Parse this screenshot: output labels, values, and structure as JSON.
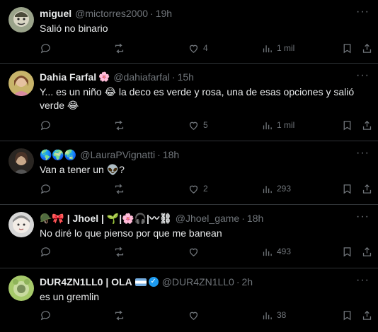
{
  "posts": [
    {
      "name": "miguel",
      "name_deco": "",
      "handle": "@mictorres2000",
      "time": "19h",
      "text": "Salió no binario",
      "replies": "",
      "reposts": "",
      "likes": "4",
      "views": "1 mil",
      "avatar_icon": "cartoon-face-avatar"
    },
    {
      "name": "Dahia Farfal",
      "name_deco": "🌸",
      "handle": "@dahiafarfal",
      "time": "15h",
      "text": "Y... es un niño 😂 la deco es verde y rosa, una de esas opciones y salió verde 😂",
      "replies": "",
      "reposts": "",
      "likes": "5",
      "views": "1 mil",
      "avatar_icon": "woman-photo-avatar"
    },
    {
      "name": "🌎🌍🌏",
      "name_deco": "",
      "handle": "@LauraPVignatti",
      "time": "18h",
      "text": "Van a tener un 👽?",
      "replies": "",
      "reposts": "",
      "likes": "2",
      "views": "293",
      "avatar_icon": "dark-photo-avatar"
    },
    {
      "name": "🪖🎀 | Jhoel | 🌱|🌸🎧|〰⛓",
      "name_deco": "",
      "handle": "@Jhoel_game",
      "time": "18h",
      "text": "No diré lo que pienso por que me banean",
      "replies": "",
      "reposts": "",
      "likes": "",
      "views": "493",
      "avatar_icon": "pale-character-avatar"
    },
    {
      "name": "DUR4ZN1LL0 | OLA",
      "name_deco": "",
      "handle": "@DUR4ZN1LL0",
      "time": "2h",
      "text": "es un gremlin",
      "replies": "",
      "reposts": "",
      "likes": "",
      "views": "38",
      "avatar_icon": "green-creature-avatar"
    }
  ],
  "colors": {
    "background": "#000000",
    "text": "#e7e9ea",
    "muted": "#71767b",
    "divider": "#2f3336",
    "verified": "#1d9bf0"
  }
}
